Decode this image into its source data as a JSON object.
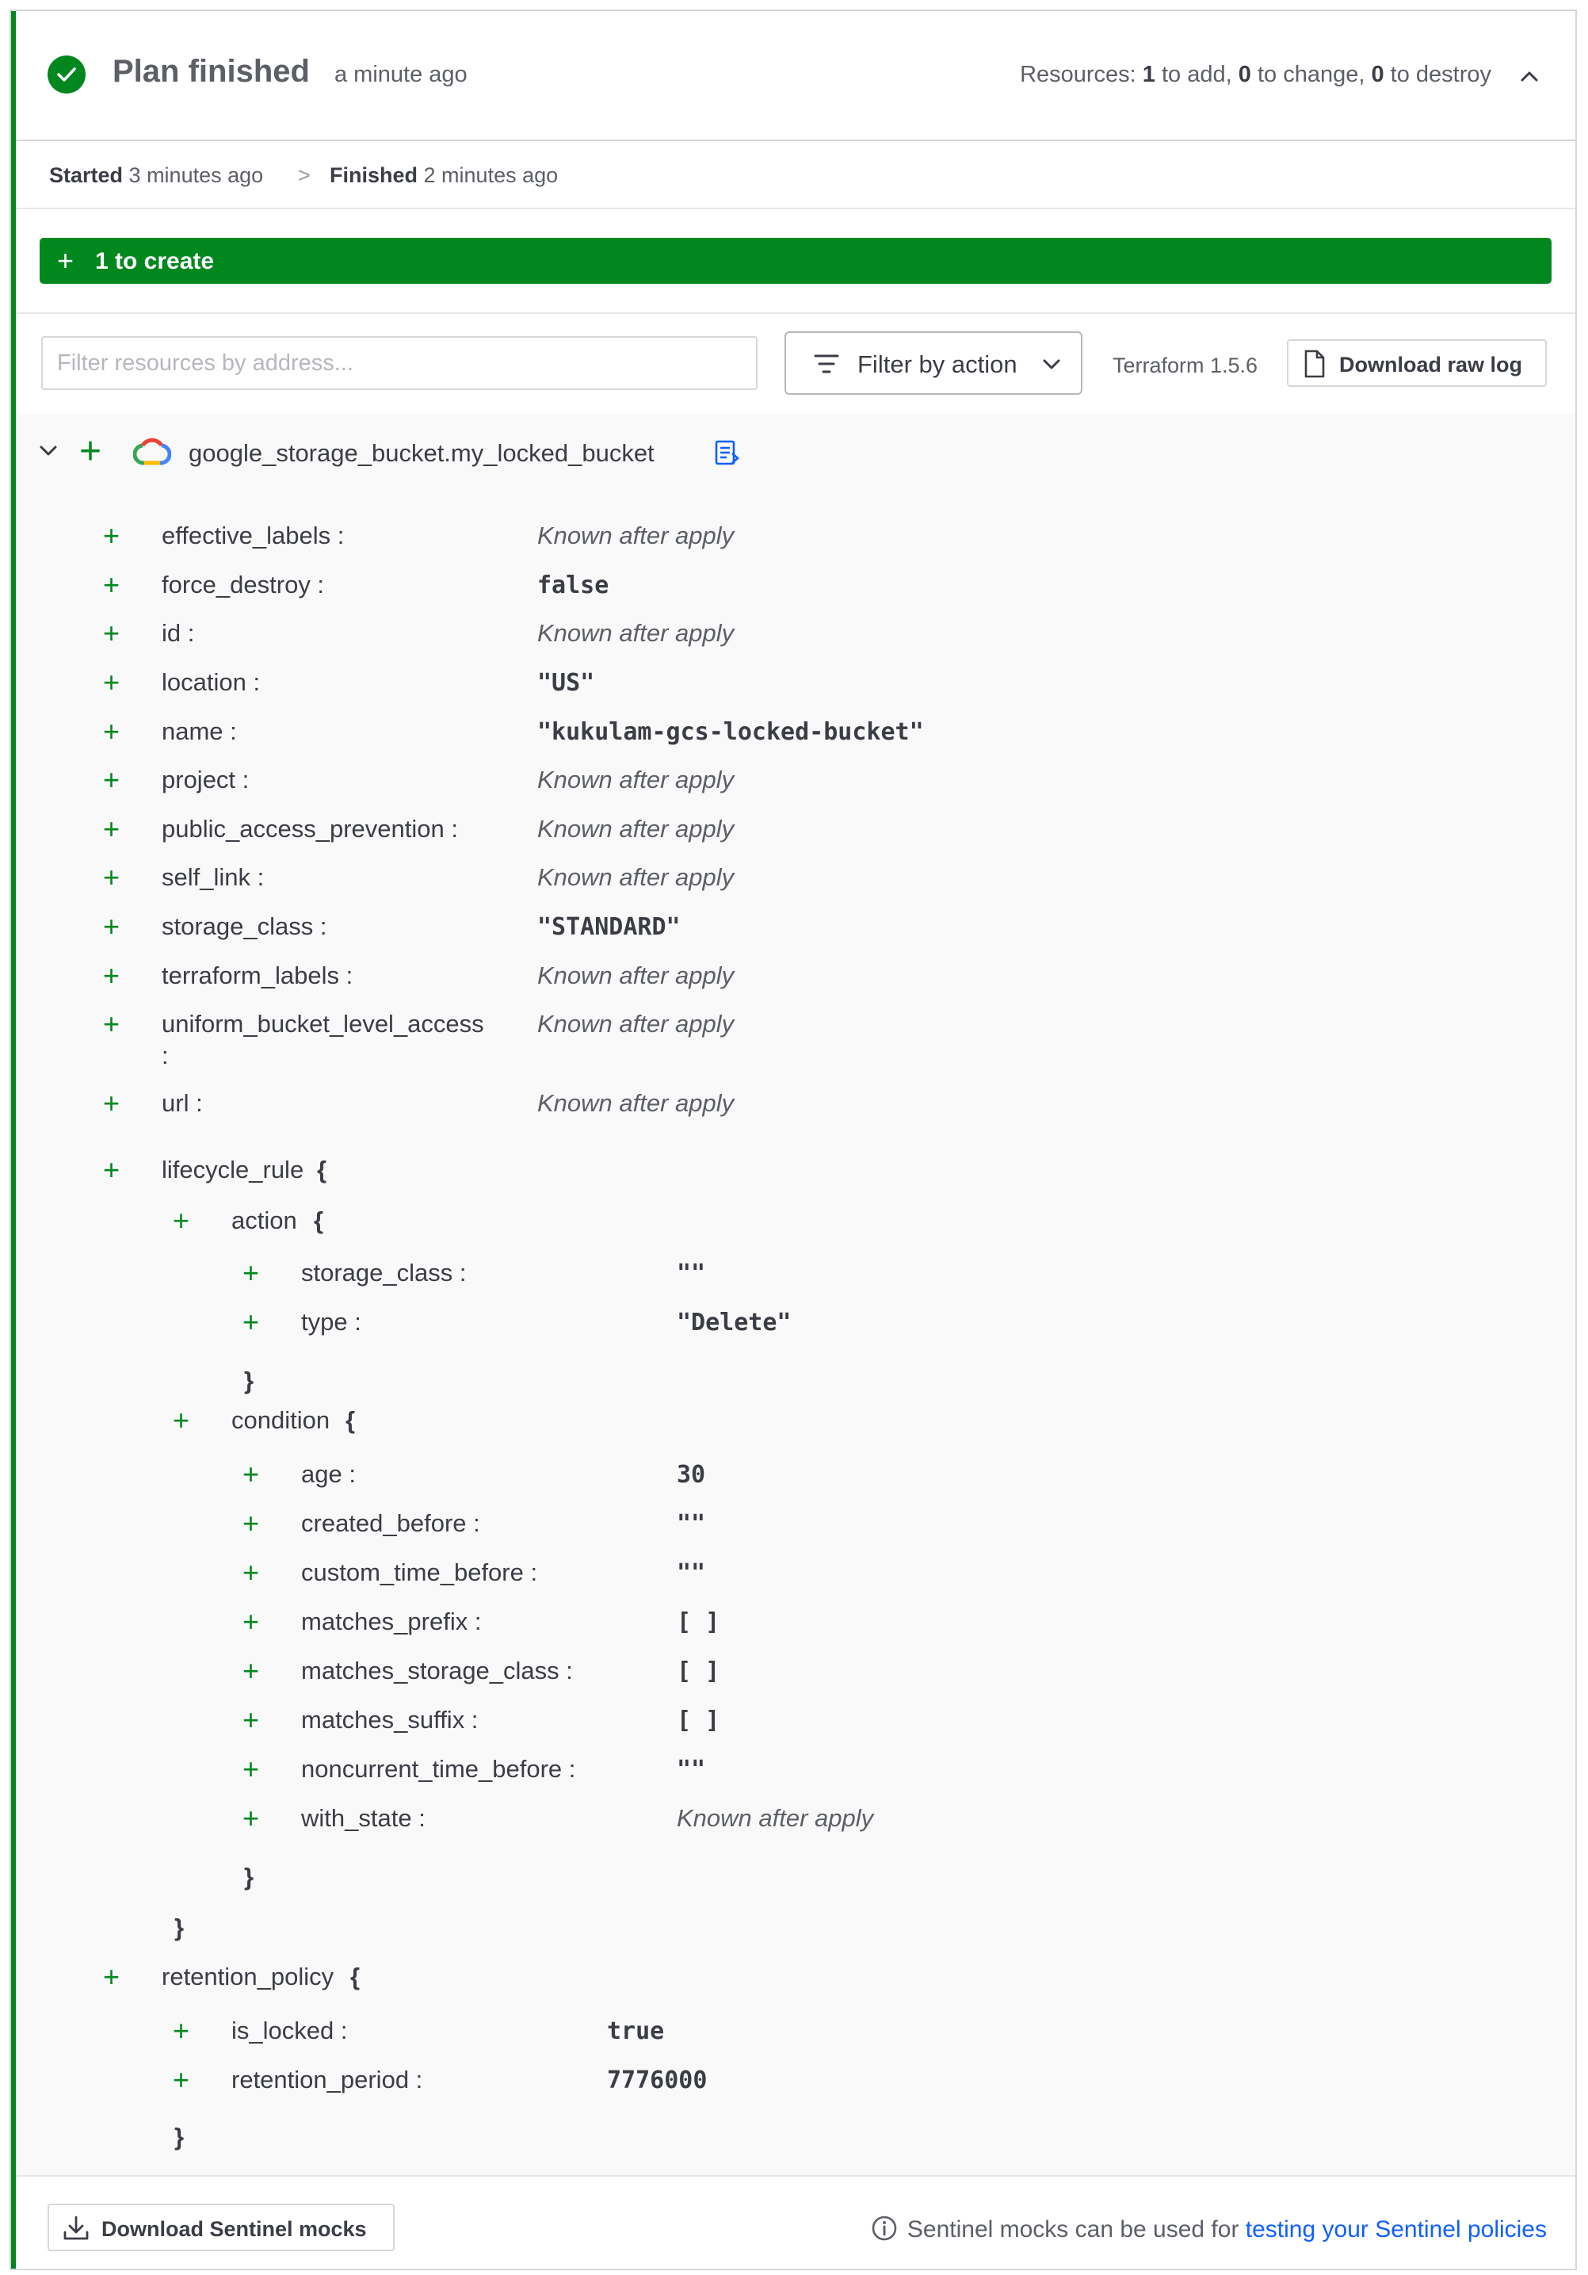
{
  "header": {
    "title": "Plan finished",
    "ago": "a minute ago",
    "resources_prefix": "Resources: ",
    "add_count": "1",
    "add_text": " to add, ",
    "change_count": "0",
    "change_text": " to change, ",
    "destroy_count": "0",
    "destroy_text": " to destroy"
  },
  "timeline": {
    "started_label": "Started",
    "started_value": "3 minutes ago",
    "separator": ">",
    "finished_label": "Finished",
    "finished_value": "2 minutes ago"
  },
  "create_bar": {
    "plus": "+",
    "label": "1 to create"
  },
  "toolbar": {
    "filter_placeholder": "Filter resources by address...",
    "filter_action_label": "Filter by action",
    "terraform_version": "Terraform 1.5.6",
    "download_raw_log": "Download raw log"
  },
  "resource": {
    "plus": "+",
    "name": "google_storage_bucket.my_locked_bucket",
    "attributes": [
      {
        "key": "effective_labels :",
        "value": "Known after apply",
        "kind": "known"
      },
      {
        "key": "force_destroy :",
        "value": "false",
        "kind": "code"
      },
      {
        "key": "id :",
        "value": "Known after apply",
        "kind": "known"
      },
      {
        "key": "location :",
        "value": "\"US\"",
        "kind": "code"
      },
      {
        "key": "name :",
        "value": "\"kukulam-gcs-locked-bucket\"",
        "kind": "code"
      },
      {
        "key": "project :",
        "value": "Known after apply",
        "kind": "known"
      },
      {
        "key": "public_access_prevention :",
        "value": "Known after apply",
        "kind": "known"
      },
      {
        "key": "self_link :",
        "value": "Known after apply",
        "kind": "known"
      },
      {
        "key": "storage_class :",
        "value": "\"STANDARD\"",
        "kind": "code"
      },
      {
        "key": "terraform_labels :",
        "value": "Known after apply",
        "kind": "known"
      },
      {
        "key": "uniform_bucket_level_access",
        "key_cont": ":",
        "value": "Known after apply",
        "kind": "known"
      },
      {
        "key": "url :",
        "value": "Known after apply",
        "kind": "known"
      }
    ],
    "lifecycle_rule": {
      "label": "lifecycle_rule",
      "open": "{",
      "close": "}",
      "action": {
        "label": "action",
        "open": "{",
        "close": "}",
        "attributes": [
          {
            "key": "storage_class :",
            "value": "\"\"",
            "kind": "code"
          },
          {
            "key": "type :",
            "value": "\"Delete\"",
            "kind": "code"
          }
        ]
      },
      "condition": {
        "label": "condition",
        "open": "{",
        "close": "}",
        "attributes": [
          {
            "key": "age :",
            "value": "30",
            "kind": "code"
          },
          {
            "key": "created_before :",
            "value": "\"\"",
            "kind": "code"
          },
          {
            "key": "custom_time_before :",
            "value": "\"\"",
            "kind": "code"
          },
          {
            "key": "matches_prefix :",
            "value": "[ ]",
            "kind": "code"
          },
          {
            "key": "matches_storage_class :",
            "value": "[ ]",
            "kind": "code"
          },
          {
            "key": "matches_suffix :",
            "value": "[ ]",
            "kind": "code"
          },
          {
            "key": "noncurrent_time_before :",
            "value": "\"\"",
            "kind": "code"
          },
          {
            "key": "with_state :",
            "value": "Known after apply",
            "kind": "known"
          }
        ]
      }
    },
    "retention_policy": {
      "label": "retention_policy",
      "open": "{",
      "close": "}",
      "attributes": [
        {
          "key": "is_locked :",
          "value": "true",
          "kind": "code"
        },
        {
          "key": "retention_period :",
          "value": "7776000",
          "kind": "code"
        }
      ]
    }
  },
  "footer": {
    "download_mocks": "Download Sentinel mocks",
    "note_text": "Sentinel mocks can be used for ",
    "note_link": "testing your Sentinel policies"
  },
  "colors": {
    "accent": "#00871e",
    "link": "#1060ff"
  },
  "icons": {
    "status": "check-circle-icon",
    "collapse": "chevron-up-icon",
    "filter": "filter-lines-icon",
    "dropdown": "chevron-down-icon",
    "log": "document-icon",
    "provider": "google-cloud-icon",
    "copy": "copy-address-icon",
    "download": "download-icon",
    "info": "info-icon"
  }
}
